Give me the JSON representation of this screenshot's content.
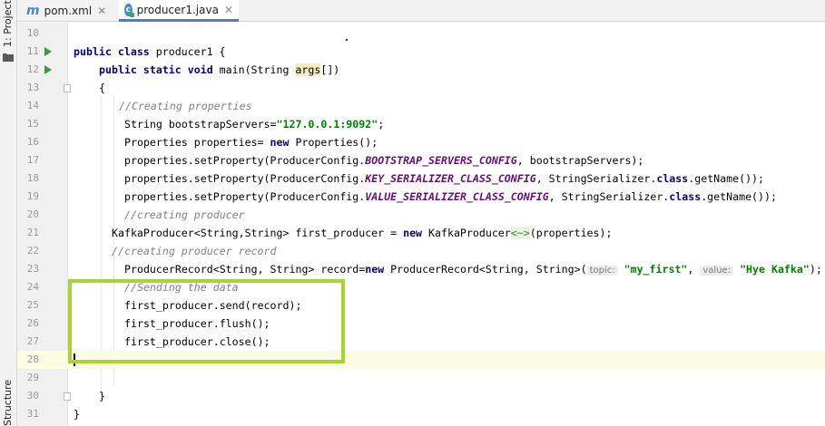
{
  "tool_windows": {
    "project_label": "1: Project",
    "structure_label": "Structure"
  },
  "tabs": [
    {
      "label": "pom.xml",
      "icon": "maven-icon",
      "active": false
    },
    {
      "label": "producer1.java",
      "icon": "java-class-icon",
      "active": true
    }
  ],
  "editor": {
    "lines": [
      {
        "num": "10"
      },
      {
        "num": "11"
      },
      {
        "num": "12"
      },
      {
        "num": "13"
      },
      {
        "num": "14"
      },
      {
        "num": "15"
      },
      {
        "num": "16"
      },
      {
        "num": "17"
      },
      {
        "num": "18"
      },
      {
        "num": "19"
      },
      {
        "num": "20"
      },
      {
        "num": "21"
      },
      {
        "num": "22"
      },
      {
        "num": "23"
      },
      {
        "num": "24"
      },
      {
        "num": "25"
      },
      {
        "num": "26"
      },
      {
        "num": "27"
      },
      {
        "num": "28"
      },
      {
        "num": "29"
      },
      {
        "num": "30"
      },
      {
        "num": "31"
      }
    ],
    "code": {
      "l11_public": "public",
      "l11_class": "class",
      "l11_rest": " producer1 {",
      "l12_public": "public",
      "l12_static": "static",
      "l12_void": "void",
      "l12_main": " main(String ",
      "l12_args": "args",
      "l12_end": "[])",
      "l13": "{",
      "l14": "//Creating properties",
      "l15_a": "String bootstrapServers=",
      "l15_str": "\"127.0.0.1:9092\"",
      "l15_end": ";",
      "l16_a": "Properties properties= ",
      "l16_new": "new",
      "l16_end": " Properties();",
      "l17_a": "properties.setProperty(ProducerConfig.",
      "l17_const": "BOOTSTRAP_SERVERS_CONFIG",
      "l17_end": ", bootstrapServers);",
      "l18_a": "properties.setProperty(ProducerConfig.",
      "l18_const": "KEY_SERIALIZER_CLASS_CONFIG",
      "l18_b": ", StringSerializer.",
      "l18_class": "class",
      "l18_end": ".getName());",
      "l19_a": "properties.setProperty(ProducerConfig.",
      "l19_const": "VALUE_SERIALIZER_CLASS_CONFIG",
      "l19_b": ", StringSerializer.",
      "l19_class": "class",
      "l19_end": ".getName());",
      "l20": "//creating producer",
      "l21_a": "KafkaProducer<String,String> first_producer = ",
      "l21_new": "new",
      "l21_b": " KafkaProducer",
      "l21_diamond": "<~>",
      "l21_end": "(properties);",
      "l22": "//creating producer record",
      "l23_a": "ProducerRecord<String, String> record=",
      "l23_new": "new",
      "l23_b": " ProducerRecord<String, String>(",
      "l23_hint1": "topic:",
      "l23_str1": "\"my_first\"",
      "l23_comma": ", ",
      "l23_hint2": "value:",
      "l23_str2": "\"Hye Kafka\"",
      "l23_end": ");",
      "l24": "//Sending the data",
      "l25": "first_producer.send(record);",
      "l26": "first_producer.flush();",
      "l27": "first_producer.close();",
      "l30": "}",
      "l31": "}"
    }
  },
  "colors": {
    "keyword": "#000080",
    "comment": "#808080",
    "string": "#008000",
    "constant": "#660e7a",
    "annotation_box": "#a4d631",
    "current_line": "#fefbe4"
  }
}
